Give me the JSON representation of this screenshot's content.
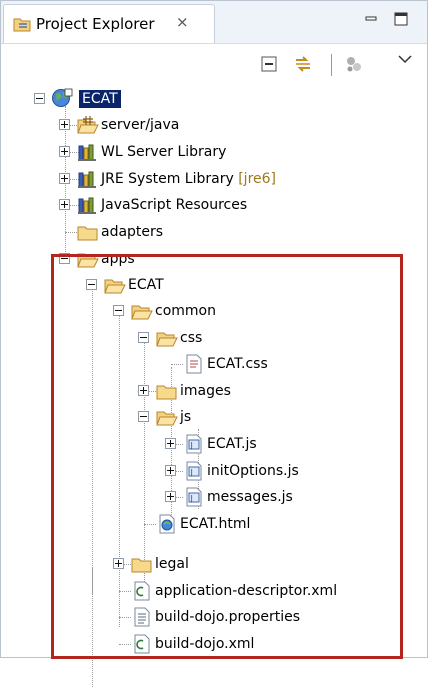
{
  "view": {
    "title": "Project Explorer",
    "close_icon": "close-x-icon",
    "minimize_icon": "minimize-icon",
    "maximize_icon": "maximize-icon"
  },
  "toolbar": {
    "icons": [
      "collapse-all-icon",
      "link-with-editor-icon",
      "filters-icon",
      "view-menu-icon"
    ]
  },
  "tree": {
    "root": {
      "label": "ECAT",
      "icon": "project-globe-icon",
      "selected": true,
      "expanded": true
    },
    "items": [
      {
        "label": "server/java",
        "icon": "source-folder-icon",
        "expanded": false
      },
      {
        "label": "WL Server Library",
        "icon": "library-icon",
        "expanded": false
      },
      {
        "label": "JRE System Library",
        "decoration": "[jre6]",
        "icon": "library-icon",
        "expanded": false
      },
      {
        "label": "JavaScript Resources",
        "icon": "library-icon",
        "expanded": false
      },
      {
        "label": "adapters",
        "icon": "folder-icon"
      },
      {
        "label": "apps",
        "icon": "folder-open-icon",
        "expanded": true
      },
      {
        "label": "ECAT",
        "icon": "folder-open-icon",
        "expanded": true
      },
      {
        "label": "common",
        "icon": "folder-open-icon",
        "expanded": true
      },
      {
        "label": "css",
        "icon": "folder-open-icon",
        "expanded": true
      },
      {
        "label": "ECAT.css",
        "icon": "css-file-icon"
      },
      {
        "label": "images",
        "icon": "folder-icon",
        "expanded": false
      },
      {
        "label": "js",
        "icon": "folder-open-icon",
        "expanded": true
      },
      {
        "label": "ECAT.js",
        "icon": "js-file-icon",
        "expanded": false
      },
      {
        "label": "initOptions.js",
        "icon": "js-file-icon",
        "expanded": false
      },
      {
        "label": "messages.js",
        "icon": "js-file-icon",
        "expanded": false
      },
      {
        "label": "ECAT.html",
        "icon": "html-file-icon"
      },
      {
        "label": "legal",
        "icon": "folder-icon",
        "expanded": false
      },
      {
        "label": "application-descriptor.xml",
        "icon": "xml-file-icon"
      },
      {
        "label": "build-dojo.properties",
        "icon": "properties-file-icon"
      },
      {
        "label": "build-dojo.xml",
        "icon": "xml-file-icon"
      }
    ]
  },
  "colors": {
    "selection": "#0a246a",
    "highlight_border": "#b3261e",
    "decoration": "#9a7a1a",
    "folder": "#f4c86a"
  }
}
